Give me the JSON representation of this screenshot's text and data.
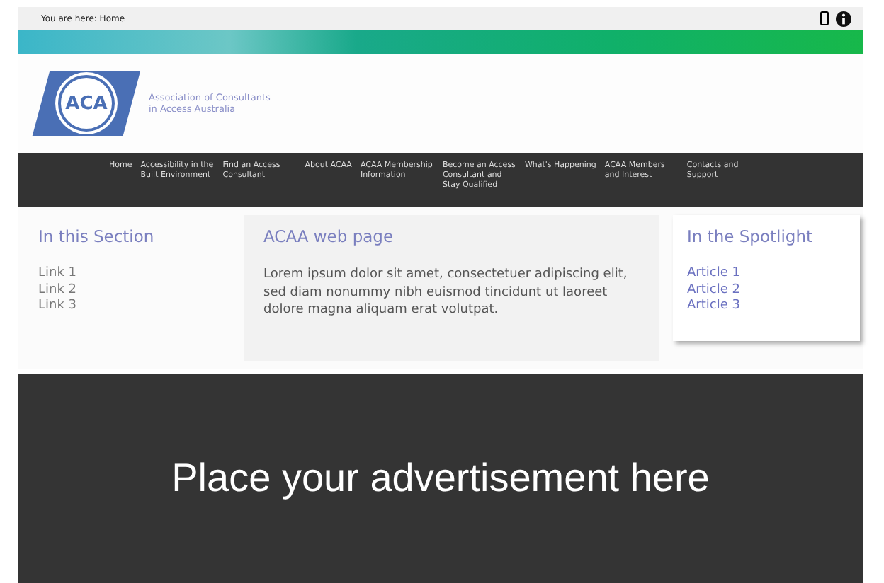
{
  "breadcrumb": "You are here: Home",
  "logo": {
    "mark": "ACA",
    "name_line_1": "Association of Consultants",
    "name_line_2": "in Access Australia"
  },
  "nav": {
    "items": [
      {
        "label": "Home"
      },
      {
        "label": "Accessibility in the Built Environment"
      },
      {
        "label": "Find an Access Consultant"
      },
      {
        "label": "About ACAA"
      },
      {
        "label": "ACAA Membership Information"
      },
      {
        "label": "Become an Access Consultant and Stay Qualified"
      },
      {
        "label": "What's Happening"
      },
      {
        "label": "ACAA Members and Interest"
      },
      {
        "label": "Contacts and Support"
      }
    ]
  },
  "section": {
    "title": "In this Section",
    "links": [
      "Link 1",
      "Link 2",
      "Link 3"
    ]
  },
  "main": {
    "title": "ACAA web page",
    "text": "Lorem ipsum dolor sit amet, consectetuer adipiscing elit, sed diam nonummy nibh euismod tincidunt ut laoreet dolore magna aliquam erat volutpat."
  },
  "spotlight": {
    "title": "In the Spotlight",
    "links": [
      "Article 1",
      "Article 2",
      "Article 3"
    ]
  },
  "advert": "Place your advertisement here"
}
